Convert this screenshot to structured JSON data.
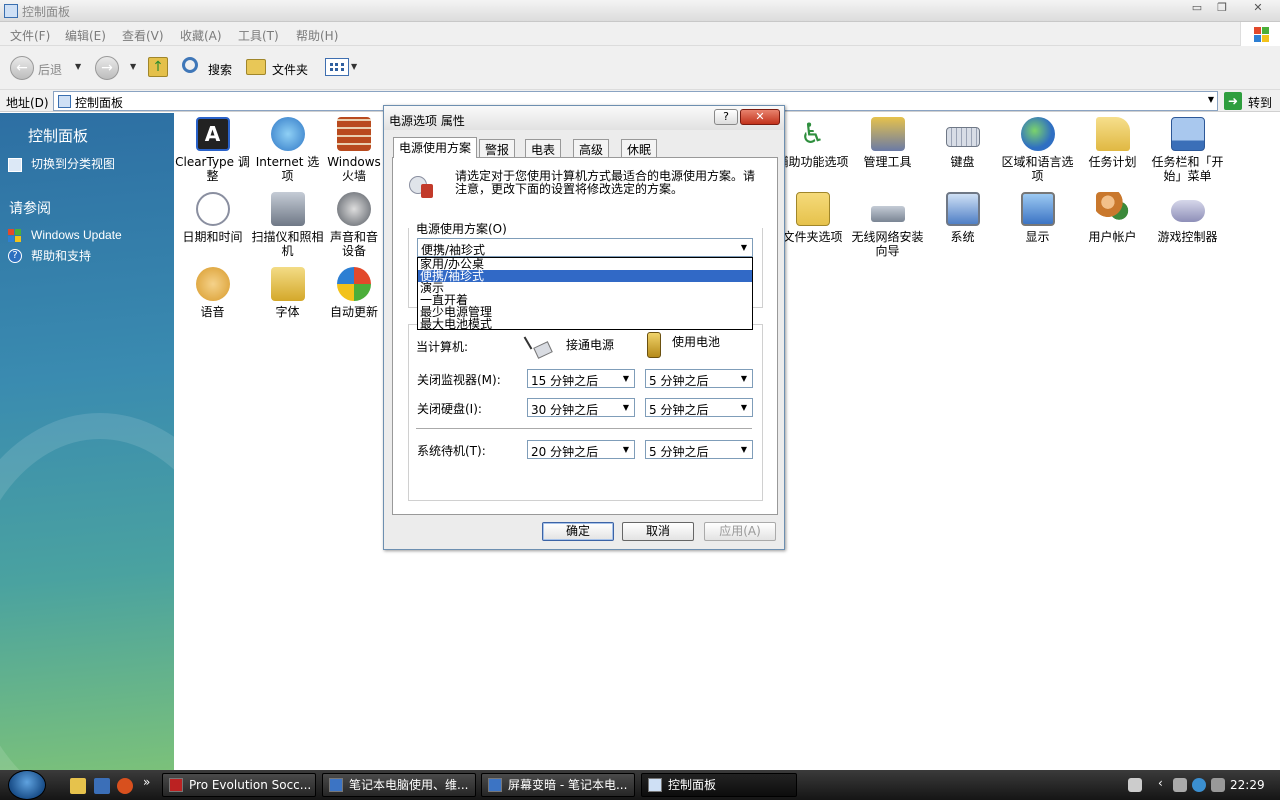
{
  "window": {
    "title": "控制面板",
    "controls": [
      "▭",
      "❐",
      "✕"
    ]
  },
  "menu": [
    "文件(F)",
    "编辑(E)",
    "查看(V)",
    "收藏(A)",
    "工具(T)",
    "帮助(H)"
  ],
  "toolbar": {
    "back": "后退",
    "search": "搜索",
    "folders": "文件夹"
  },
  "address": {
    "label": "地址(D)",
    "value": "控制面板",
    "go": "转到"
  },
  "sidebar": {
    "title": "控制面板",
    "switch_view": "切换到分类视图",
    "see_also_title": "请参阅",
    "links": [
      "Windows Update",
      "帮助和支持"
    ]
  },
  "icons": [
    {
      "label": "ClearType 调整",
      "icon": "cleartype-icon",
      "color": "#2a62c9"
    },
    {
      "label": "Internet 选项",
      "icon": "internet-options-icon",
      "color": "#3c8fd8"
    },
    {
      "label": "Windows 火墙",
      "icon": "firewall-icon",
      "color": "#b94a1e"
    },
    {
      "label": "日期和时间",
      "icon": "clock-icon",
      "color": "#8a8fa0"
    },
    {
      "label": "扫描仪和照相机",
      "icon": "scanner-icon",
      "color": "#6f7886"
    },
    {
      "label": "声音和音设备",
      "icon": "speaker-icon",
      "color": "#555a62"
    },
    {
      "label": "语音",
      "icon": "speech-icon",
      "color": "#d89a2a"
    },
    {
      "label": "字体",
      "icon": "fonts-folder-icon",
      "color": "#e3c14a"
    },
    {
      "label": "自动更新",
      "icon": "auto-update-icon",
      "color": "#3a78c9"
    },
    {
      "label": "辅助功能选项",
      "icon": "accessibility-icon",
      "color": "#2f8f3e"
    },
    {
      "label": "管理工具",
      "icon": "admin-tools-icon",
      "color": "#6a7aa6"
    },
    {
      "label": "键盘",
      "icon": "keyboard-icon",
      "color": "#9aa3b5"
    },
    {
      "label": "区域和语言选项",
      "icon": "globe-icon",
      "color": "#2f6fc2"
    },
    {
      "label": "任务计划",
      "icon": "scheduled-tasks-icon",
      "color": "#e0b842"
    },
    {
      "label": "任务栏和「开始」菜单",
      "icon": "taskbar-icon",
      "color": "#3b6fb8"
    },
    {
      "label": "文件夹选项",
      "icon": "folder-options-icon",
      "color": "#e6c24c"
    },
    {
      "label": "无线网络安装向导",
      "icon": "wireless-icon",
      "color": "#7a8594"
    },
    {
      "label": "系统",
      "icon": "system-icon",
      "color": "#4f7fc6"
    },
    {
      "label": "显示",
      "icon": "display-icon",
      "color": "#3c74c4"
    },
    {
      "label": "用户帐户",
      "icon": "user-accounts-icon",
      "color": "#c9782d"
    },
    {
      "label": "游戏控制器",
      "icon": "gamepad-icon",
      "color": "#8e8fb8"
    }
  ],
  "dialog": {
    "title": "电源选项 属性",
    "help": "?",
    "close": "✕",
    "tabs": [
      "电源使用方案",
      "警报",
      "电表",
      "高级",
      "休眠"
    ],
    "description": "请选定对于您使用计算机方式最适合的电源使用方案。请注意，更改下面的设置将修改选定的方案。",
    "scheme_label": "电源使用方案(O)",
    "scheme_selected": "便携/袖珍式",
    "scheme_options": [
      "家用/办公桌",
      "便携/袖珍式",
      "演示",
      "一直开着",
      "最少电源管理",
      "最大电池模式"
    ],
    "when_computer": "当计算机:",
    "plugged_in": "接通电源",
    "on_battery": "使用电池",
    "rows": [
      {
        "label": "关闭监视器(M):",
        "ac": "15 分钟之后",
        "dc": "5 分钟之后"
      },
      {
        "label": "关闭硬盘(I):",
        "ac": "30 分钟之后",
        "dc": "5 分钟之后"
      },
      {
        "label": "系统待机(T):",
        "ac": "20 分钟之后",
        "dc": "5 分钟之后"
      }
    ],
    "buttons": {
      "ok": "确定",
      "cancel": "取消",
      "apply": "应用(A)"
    }
  },
  "taskbar": {
    "overflow": "»",
    "tasks": [
      "Pro Evolution Socc...",
      "笔记本电脑使用、维...",
      "屏幕变暗 - 笔记本电...",
      "控制面板"
    ],
    "clock": "22:29"
  }
}
